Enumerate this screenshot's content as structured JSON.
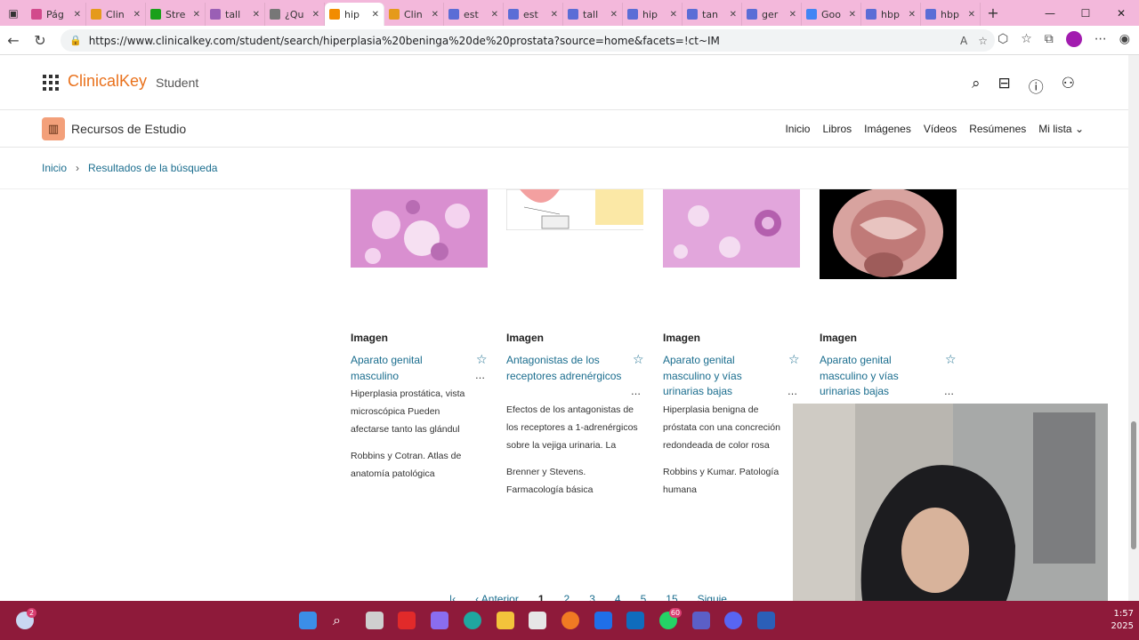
{
  "browser": {
    "tabs": [
      {
        "title": "Pág",
        "color": "#d24a8c",
        "active": false
      },
      {
        "title": "Clin",
        "color": "#e59a1b",
        "active": false
      },
      {
        "title": "Stre",
        "color": "#1aa01a",
        "active": false
      },
      {
        "title": "tall",
        "color": "#9a5fb5",
        "active": false
      },
      {
        "title": "¿Qu",
        "color": "#777777",
        "active": false
      },
      {
        "title": "hip",
        "color": "#f28c00",
        "active": true
      },
      {
        "title": "Clin",
        "color": "#e59a1b",
        "active": false
      },
      {
        "title": "est",
        "color": "#5b6dd6",
        "active": false
      },
      {
        "title": "est",
        "color": "#5b6dd6",
        "active": false
      },
      {
        "title": "tall",
        "color": "#5b6dd6",
        "active": false
      },
      {
        "title": "hip",
        "color": "#5b6dd6",
        "active": false
      },
      {
        "title": "tan",
        "color": "#5b6dd6",
        "active": false
      },
      {
        "title": "ger",
        "color": "#5b6dd6",
        "active": false
      },
      {
        "title": "Goo",
        "color": "#4285f4",
        "active": false
      },
      {
        "title": "hbp",
        "color": "#5b6dd6",
        "active": false
      },
      {
        "title": "hbp",
        "color": "#5b6dd6",
        "active": false
      }
    ],
    "url": "https://www.clinicalkey.com/student/search/hiperplasia%20beninga%20de%20prostata?source=home&facets=!ct~IM"
  },
  "site": {
    "logo": "ClinicalKey",
    "logo_sub": "Student",
    "section_title": "Recursos de Estudio",
    "menu": [
      "Inicio",
      "Libros",
      "Imágenes",
      "Vídeos",
      "Resúmenes",
      "Mi lista"
    ],
    "breadcrumb": [
      "Inicio",
      "Resultados de la búsqueda"
    ]
  },
  "cards": [
    {
      "type": "Imagen",
      "title": "Aparato genital masculino",
      "desc": "Hiperplasia prostática, vista microscópica Pueden afectarse tanto las glándul",
      "source": "Robbins y Cotran. Atlas de anatomía patológica"
    },
    {
      "type": "Imagen",
      "title": "Antagonistas de los receptores adrenérgicos",
      "desc": "Efectos de los antagonistas de los receptores a 1-adrenérgicos sobre la vejiga urinaria. La",
      "source": "Brenner y Stevens. Farmacología básica"
    },
    {
      "type": "Imagen",
      "title": "Aparato genital masculino y vías urinarias bajas",
      "desc": "Hiperplasia benigna de próstata con una concreción redondeada de color rosa",
      "source": "Robbins y Kumar. Patología humana"
    },
    {
      "type": "Imagen",
      "title": "Aparato genital masculino y vías urinarias bajas",
      "desc": "",
      "source": ""
    }
  ],
  "pager": {
    "prev": "Anterior",
    "pages": [
      "1",
      "2",
      "3",
      "4",
      "5",
      "15"
    ],
    "next": "Siguie"
  },
  "taskbar": {
    "time": "1:57",
    "date": "2025",
    "badge_weather": "2",
    "badge_whatsapp": "60"
  }
}
